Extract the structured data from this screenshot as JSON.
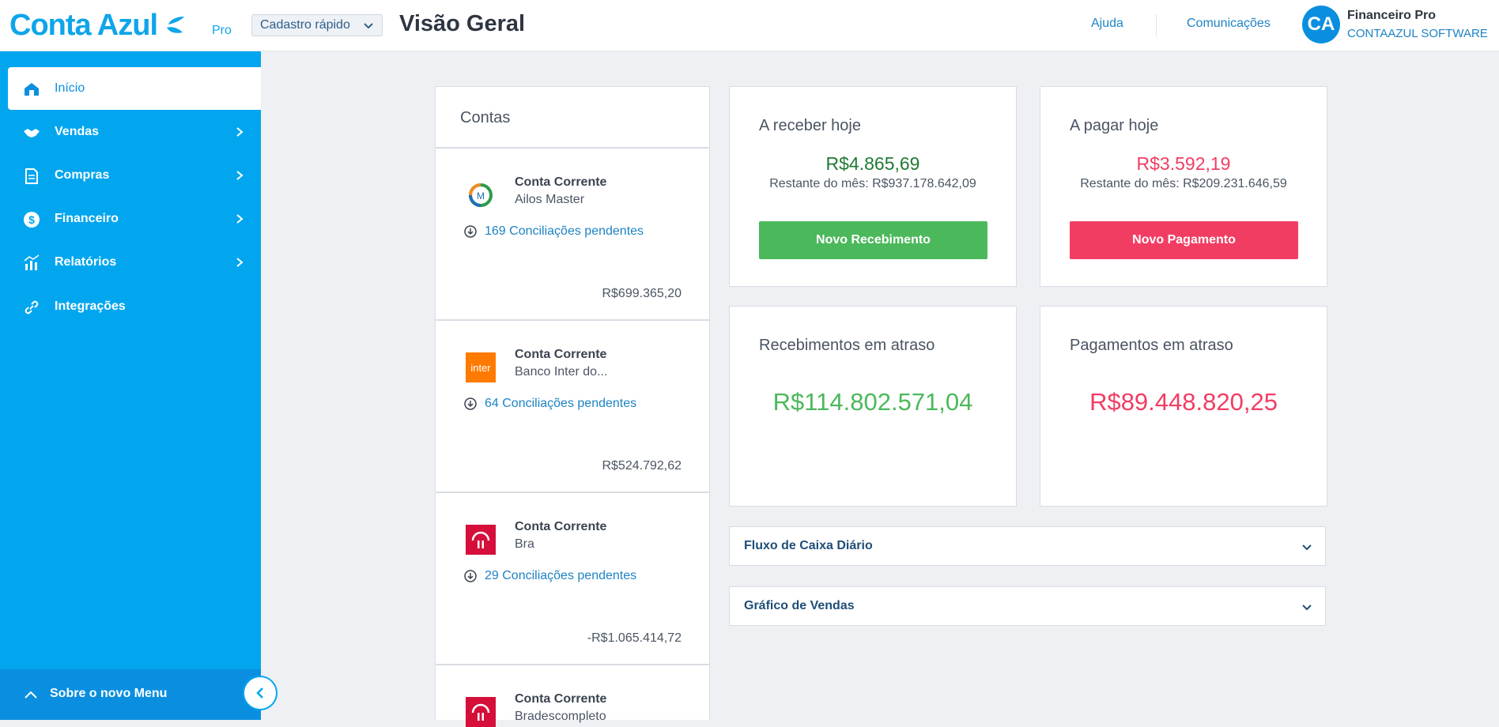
{
  "header": {
    "logo_text": "Conta Azul",
    "logo_badge": "Pro",
    "quick_add_label": "Cadastro rápido",
    "page_title": "Visão Geral",
    "help_link": "Ajuda",
    "communications_link": "Comunicações",
    "avatar_initials": "CA",
    "user_name": "Financeiro Pro",
    "user_company": "CONTAAZUL SOFTWARE"
  },
  "sidebar": {
    "items": [
      {
        "label": "Início",
        "icon": "home-icon",
        "active": true
      },
      {
        "label": "Vendas",
        "icon": "handshake-icon"
      },
      {
        "label": "Compras",
        "icon": "document-icon"
      },
      {
        "label": "Financeiro",
        "icon": "dollar-icon"
      },
      {
        "label": "Relatórios",
        "icon": "chart-icon"
      },
      {
        "label": "Integrações",
        "icon": "link-icon"
      }
    ],
    "footer_label": "Sobre o novo Menu"
  },
  "accounts": {
    "title": "Contas",
    "items": [
      {
        "type": "Conta Corrente",
        "name": "Ailos Master",
        "pending": "169 Conciliações pendentes",
        "balance": "R$699.365,20",
        "logo": "ailos-logo"
      },
      {
        "type": "Conta Corrente",
        "name": "Banco Inter do...",
        "pending": "64 Conciliações pendentes",
        "balance": "R$524.792,62",
        "logo": "inter-logo",
        "logo_text": "inter"
      },
      {
        "type": "Conta Corrente",
        "name": "Bra",
        "pending": "29 Conciliações pendentes",
        "balance": "-R$1.065.414,72",
        "logo": "bradesco-logo"
      },
      {
        "type": "Conta Corrente",
        "name": "Bradescompleto",
        "logo": "bradesco-logo"
      }
    ]
  },
  "receive_today": {
    "title": "A receber hoje",
    "amount": "R$4.865,69",
    "remaining": "Restante do mês: R$937.178.642,09",
    "button": "Novo Recebimento"
  },
  "pay_today": {
    "title": "A pagar hoje",
    "amount": "R$3.592,19",
    "remaining": "Restante do mês: R$209.231.646,59",
    "button": "Novo Pagamento"
  },
  "overdue_receipts": {
    "title": "Recebimentos em atraso",
    "amount": "R$114.802.571,04"
  },
  "overdue_payments": {
    "title": "Pagamentos em atraso",
    "amount": "R$89.448.820,25"
  },
  "panels": {
    "cashflow": "Fluxo de Caixa Diário",
    "sales_chart": "Gráfico de Vendas"
  },
  "colors": {
    "brand_blue": "#02a6ef",
    "green": "#4cb85c",
    "red": "#f23d63",
    "dark_green": "#1f7a33",
    "link_blue": "#1d83c4"
  }
}
